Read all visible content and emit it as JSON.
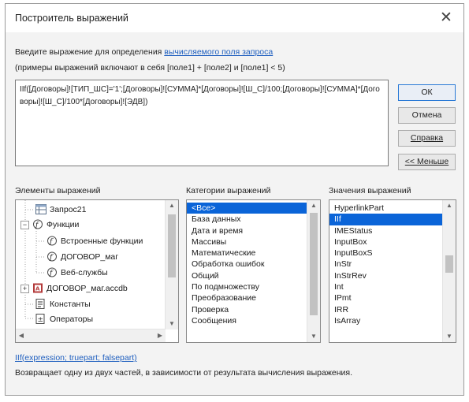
{
  "dialog": {
    "title": "Построитель выражений",
    "close_glyph": "✕",
    "instruction_prefix": "Введите выражение для определения ",
    "instruction_link": "вычисляемого поля запроса",
    "instruction_line2": "(примеры выражений включают в себя [поле1] + [поле2] и [поле1] < 5)",
    "expression": "IIf([Договоры]![ТИП_ШС]='1';[Договоры]![СУММА]*[Договоры]![Ш_С]/100;[Договоры]![СУММА]*[Договоры]![Ш_С]/100*[Договоры]![ЭДВ])"
  },
  "buttons": {
    "ok": "ОК",
    "cancel": "Отмена",
    "help": "Справка",
    "less": "<< Меньше"
  },
  "panes": {
    "elements_label": "Элементы выражений",
    "categories_label": "Категории выражений",
    "values_label": "Значения выражений",
    "elements": [
      {
        "label": "Запрос21",
        "icon": "query-icon",
        "expander": ""
      },
      {
        "label": "Функции",
        "icon": "functions-icon",
        "expander": "−"
      },
      {
        "label": "Встроенные функции",
        "icon": "function-icon",
        "expander": ""
      },
      {
        "label": "ДОГОВОР_маг",
        "icon": "function-icon",
        "expander": ""
      },
      {
        "label": "Веб-службы",
        "icon": "function-icon",
        "expander": ""
      },
      {
        "label": "ДОГОВОР_маг.accdb",
        "icon": "database-icon",
        "expander": "+"
      },
      {
        "label": "Константы",
        "icon": "constants-icon",
        "expander": ""
      },
      {
        "label": "Операторы",
        "icon": "operators-icon",
        "expander": ""
      }
    ],
    "categories": [
      "<Все>",
      "База данных",
      "Дата и время",
      "Массивы",
      "Математические",
      "Обработка ошибок",
      "Общий",
      "По подмножеству",
      "Преобразование",
      "Проверка",
      "Сообщения"
    ],
    "values": [
      "HyperlinkPart",
      "IIf",
      "IMEStatus",
      "InputBox",
      "InputBoxS",
      "InStr",
      "InStrRev",
      "Int",
      "IPmt",
      "IRR",
      "IsArray"
    ],
    "selected_category": "<Все>",
    "selected_value": "IIf"
  },
  "footer": {
    "signature": "IIf(expression; truepart; falsepart)",
    "description": "Возвращает одну из двух частей, в зависимости от результата вычисления выражения."
  }
}
